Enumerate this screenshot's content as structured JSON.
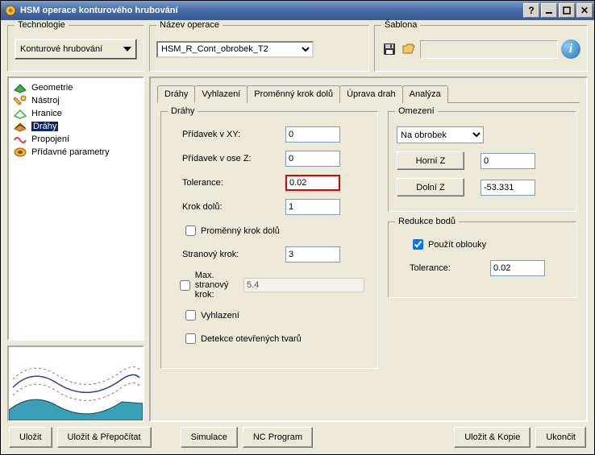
{
  "title": "HSM operace konturového hrubování",
  "tech": {
    "legend": "Technologie",
    "value": "Konturové hrubování"
  },
  "opname": {
    "legend": "Název operace",
    "value": "HSM_R_Cont_obrobek_T2"
  },
  "sablona": {
    "legend": "Šablona"
  },
  "tree": {
    "items": [
      {
        "label": "Geometrie"
      },
      {
        "label": "Nástroj"
      },
      {
        "label": "Hranice"
      },
      {
        "label": "Dráhy"
      },
      {
        "label": "Propojení"
      },
      {
        "label": "Přídavné parametry"
      }
    ]
  },
  "tabs": {
    "items": [
      {
        "label": "Dráhy"
      },
      {
        "label": "Vyhlazení"
      },
      {
        "label": "Proměnný krok dolů"
      },
      {
        "label": "Úprava drah"
      },
      {
        "label": "Analýza"
      }
    ]
  },
  "drahy": {
    "legend": "Dráhy",
    "pridavek_xy": {
      "label": "Přídavek v XY:",
      "value": "0"
    },
    "pridavek_z": {
      "label": "Přídavek v ose Z:",
      "value": "0"
    },
    "tolerance": {
      "label": "Tolerance:",
      "value": "0.02"
    },
    "krok_dolu": {
      "label": "Krok dolů:",
      "value": "1"
    },
    "promenny_krok": {
      "label": "Proměnný krok dolů"
    },
    "stranovy_krok": {
      "label": "Stranový krok:",
      "value": "3"
    },
    "max_stranovy": {
      "label": "Max. stranový krok:",
      "value": "5.4"
    },
    "vyhlazeni": {
      "label": "Vyhlazení"
    },
    "detekce": {
      "label": "Detekce otevřených tvarů"
    }
  },
  "omezeni": {
    "legend": "Omezení",
    "dropdown": "Na obrobek",
    "horni_z": {
      "label": "Horní Z",
      "value": "0"
    },
    "dolni_z": {
      "label": "Dolní Z",
      "value": "-53.331"
    }
  },
  "redukce": {
    "legend": "Redukce bodů",
    "pouzit": {
      "label": "Použít oblouky"
    },
    "tolerance": {
      "label": "Tolerance:",
      "value": "0.02"
    }
  },
  "buttons": {
    "ulozit": "Uložit",
    "ulozit_prepocitat": "Uložit & Přepočítat",
    "simulace": "Simulace",
    "nc_program": "NC Program",
    "ulozit_kopie": "Uložit & Kopie",
    "ukoncit": "Ukončit"
  }
}
